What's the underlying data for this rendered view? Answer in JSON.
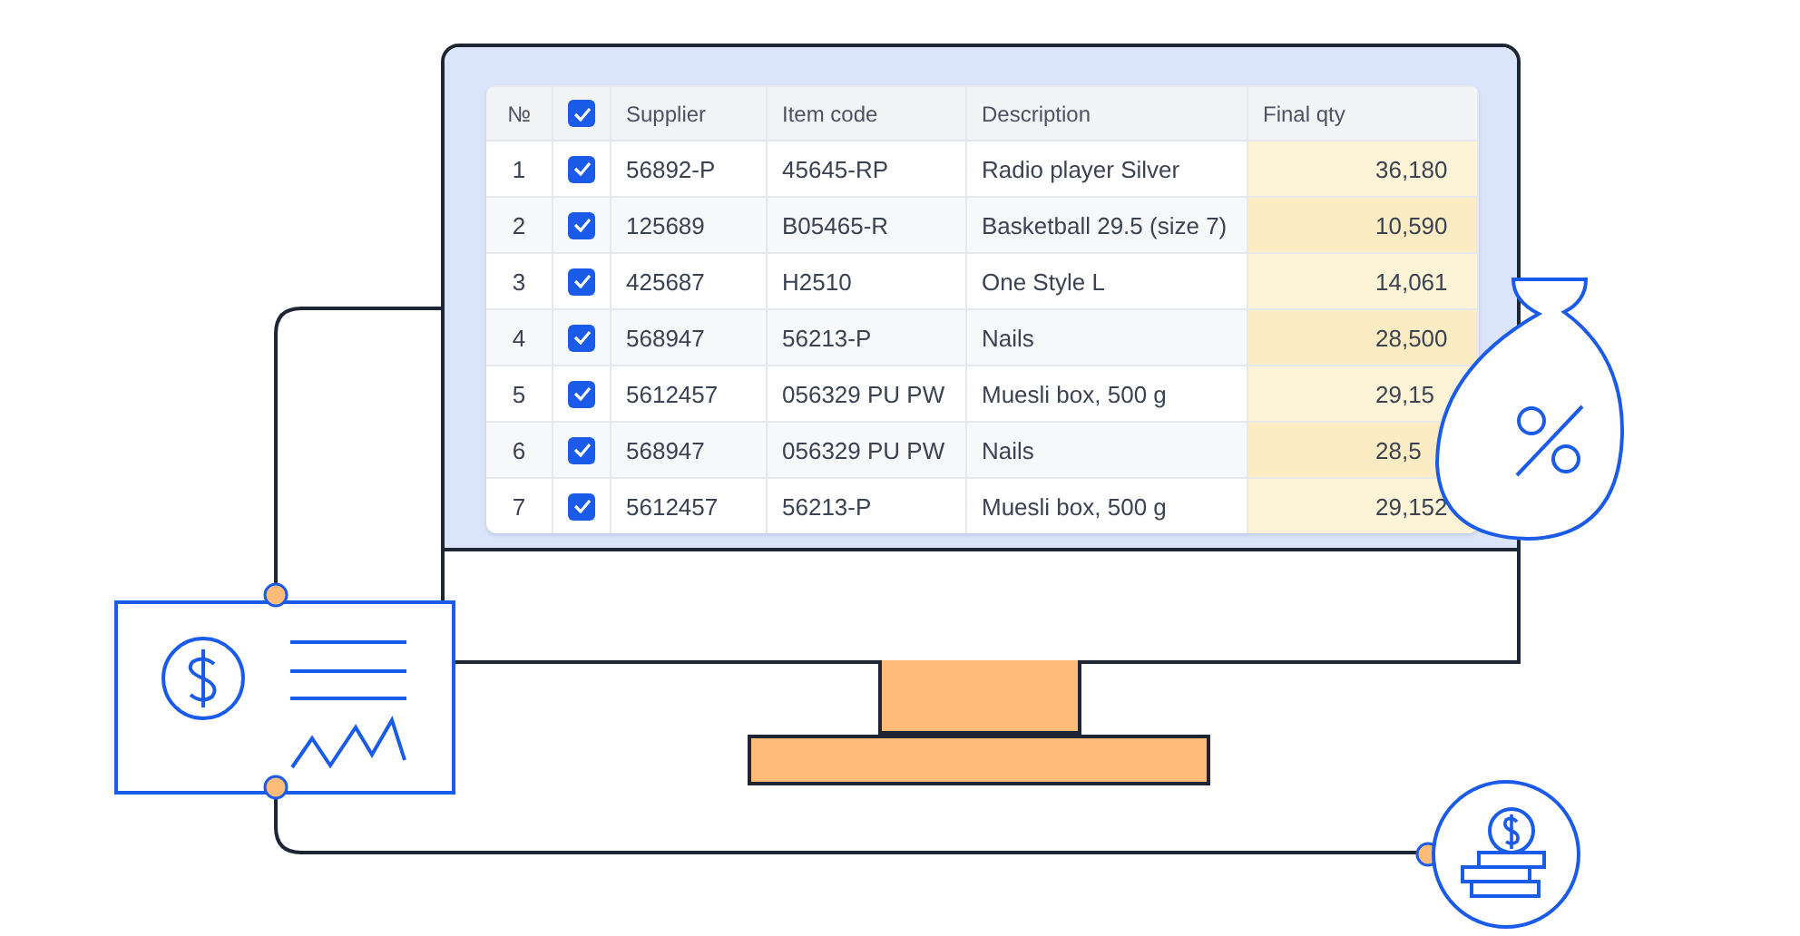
{
  "table": {
    "number_heading": "№",
    "all_checked": true,
    "columns": [
      "Supplier",
      "Item code",
      "Description",
      "Final qty"
    ],
    "rows": [
      {
        "number": "1",
        "checked": true,
        "supplier": "56892-P",
        "item_code": "45645-RP",
        "description": "Radio player Silver",
        "final_qty": "36,180"
      },
      {
        "number": "2",
        "checked": true,
        "supplier": "125689",
        "item_code": "B05465-R",
        "description": "Basketball 29.5 (size 7)",
        "final_qty": "10,590"
      },
      {
        "number": "3",
        "checked": true,
        "supplier": "425687",
        "item_code": "H2510",
        "description": "One Style L",
        "final_qty": "14,061"
      },
      {
        "number": "4",
        "checked": true,
        "supplier": "568947",
        "item_code": "56213-P",
        "description": "Nails",
        "final_qty": "28,500"
      },
      {
        "number": "5",
        "checked": true,
        "supplier": "5612457",
        "item_code": "056329 PU PW",
        "description": "Muesli box, 500 g",
        "final_qty": "29,15"
      },
      {
        "number": "6",
        "checked": true,
        "supplier": "568947",
        "item_code": "056329 PU PW",
        "description": "Nails",
        "final_qty": "28,5"
      },
      {
        "number": "7",
        "checked": true,
        "supplier": "5612457",
        "item_code": "56213-P",
        "description": "Muesli box, 500 g",
        "final_qty": "29,152"
      }
    ]
  }
}
